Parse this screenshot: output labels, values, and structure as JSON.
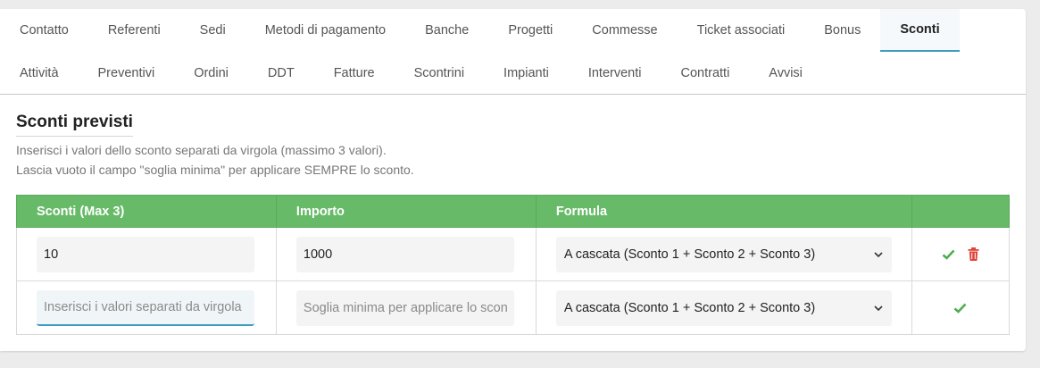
{
  "tabs": {
    "row1": [
      "Contatto",
      "Referenti",
      "Sedi",
      "Metodi di pagamento",
      "Banche",
      "Progetti",
      "Commesse",
      "Ticket associati",
      "Bonus",
      "Sconti"
    ],
    "row2": [
      "Attività",
      "Preventivi",
      "Ordini",
      "DDT",
      "Fatture",
      "Scontrini",
      "Impianti",
      "Interventi",
      "Contratti",
      "Avvisi"
    ],
    "active": "Sconti"
  },
  "section": {
    "title": "Sconti previsti",
    "help_line1": "Inserisci i valori dello sconto separati da virgola (massimo 3 valori).",
    "help_line2": "Lascia vuoto il campo \"soglia minima\" per applicare SEMPRE lo sconto."
  },
  "table": {
    "headers": [
      "Sconti (Max 3)",
      "Importo",
      "Formula",
      ""
    ],
    "rows": [
      {
        "sconti": "10",
        "importo": "1000",
        "formula": "A cascata (Sconto 1 + Sconto 2 + Sconto 3)"
      }
    ],
    "new_row": {
      "sconti_placeholder": "Inserisci i valori separati da virgola",
      "importo_placeholder": "Soglia minima per applicare lo sconto",
      "formula": "A cascata (Sconto 1 + Sconto 2 + Sconto 3)"
    }
  },
  "icons": {
    "save": "check-icon",
    "delete": "trash-icon",
    "dropdown": "chevron-down-icon"
  },
  "colors": {
    "header_green": "#67bb68",
    "check_green": "#4cae4c",
    "delete_red": "#e0453a",
    "active_tab_underline": "#3f9bbf"
  }
}
